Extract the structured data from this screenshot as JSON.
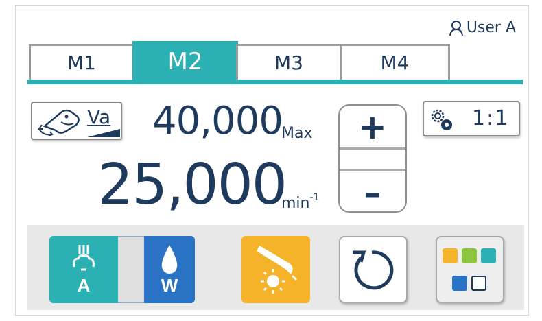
{
  "user": {
    "label": "User A",
    "icon": "user-icon"
  },
  "tabs": [
    {
      "label": "M1",
      "active": false
    },
    {
      "label": "M2",
      "active": true
    },
    {
      "label": "M3",
      "active": false
    },
    {
      "label": "M4",
      "active": false
    }
  ],
  "handpiece": {
    "mode_label": "Va",
    "icon": "handpiece-icon"
  },
  "speed": {
    "max_value": "40,000",
    "max_label": "Max",
    "current_value": "25,000",
    "unit": "min",
    "unit_exp": "-1"
  },
  "stepper": {
    "plus": "+",
    "minus": "–"
  },
  "ratio": {
    "value": "1:1",
    "icon": "gear-icon"
  },
  "controls": {
    "air_label": "A",
    "water_label": "W",
    "light_icon": "handpiece-light-icon",
    "rotation_icon": "rotation-icon",
    "menu_icon": "menu-grid-icon"
  },
  "colors": {
    "accent": "#2bb0b4",
    "water": "#2a72c4",
    "light": "#f5b329",
    "text": "#1e3a5c"
  }
}
